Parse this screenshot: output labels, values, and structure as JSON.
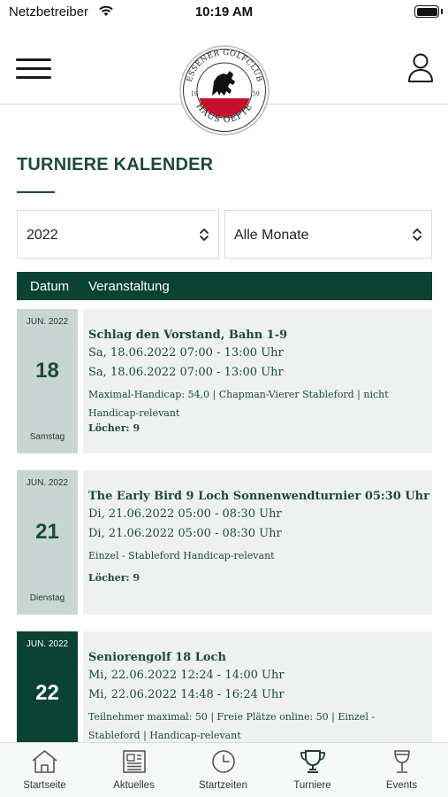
{
  "status_bar": {
    "carrier": "Netzbetreiber",
    "time": "10:19 AM"
  },
  "header": {
    "logo_text_top": "ESSENER GOLFCLUB",
    "logo_text_bottom": "HAUS OEFTE",
    "logo_year_left": "19",
    "logo_year_right": "59"
  },
  "page": {
    "title": "TURNIERE KALENDER"
  },
  "filters": {
    "year": "2022",
    "month": "Alle Monate"
  },
  "table_header": {
    "date": "Datum",
    "event": "Veranstaltung"
  },
  "events": [
    {
      "month": "JUN. 2022",
      "day": "18",
      "weekday": "Samstag",
      "name": "Schlag den Vorstand, Bahn 1-9",
      "time1": "Sa, 18.06.2022 07:00  -  13:00 Uhr",
      "time2": "Sa, 18.06.2022 07:00  -  13:00 Uhr",
      "info": "Maximal-Handicap: 54,0 | Chapman-Vierer Stableford | nicht Handicap-relevant",
      "holes": "Löcher: 9"
    },
    {
      "month": "JUN. 2022",
      "day": "21",
      "weekday": "Dienstag",
      "name": "The Early Bird 9 Loch Sonnenwendturnier 05:30 Uhr",
      "time1": "Di, 21.06.2022 05:00  -  08:30 Uhr",
      "time2": "Di, 21.06.2022 05:00  -  08:30 Uhr",
      "info": "Einzel - Stableford Handicap-relevant",
      "holes": "Löcher: 9"
    },
    {
      "month": "JUN. 2022",
      "day": "22",
      "weekday": "",
      "name": "Seniorengolf 18 Loch",
      "time1": "Mi, 22.06.2022 12:24  -  14:00 Uhr",
      "time2": "Mi, 22.06.2022 14:48  -  16:24 Uhr",
      "info": "Teilnehmer maximal: 50 | Freie Plätze online:  50 | Einzel - Stableford | Handicap-relevant",
      "holes": ""
    }
  ],
  "tabbar": {
    "tabs": [
      {
        "label": "Startseite",
        "icon": "home-icon"
      },
      {
        "label": "Aktuelles",
        "icon": "newspaper-icon"
      },
      {
        "label": "Startzeiten",
        "icon": "clock-icon"
      },
      {
        "label": "Turniere",
        "icon": "trophy-icon"
      },
      {
        "label": "Events",
        "icon": "wine-glass-icon"
      }
    ],
    "active_tab": "Turniere"
  },
  "colors": {
    "brand_green": "#0a4234",
    "text_green": "#1c4a3c",
    "card_bg": "#eef1f0",
    "date_bg": "#c9d5d2",
    "logo_red": "#c8102e"
  }
}
